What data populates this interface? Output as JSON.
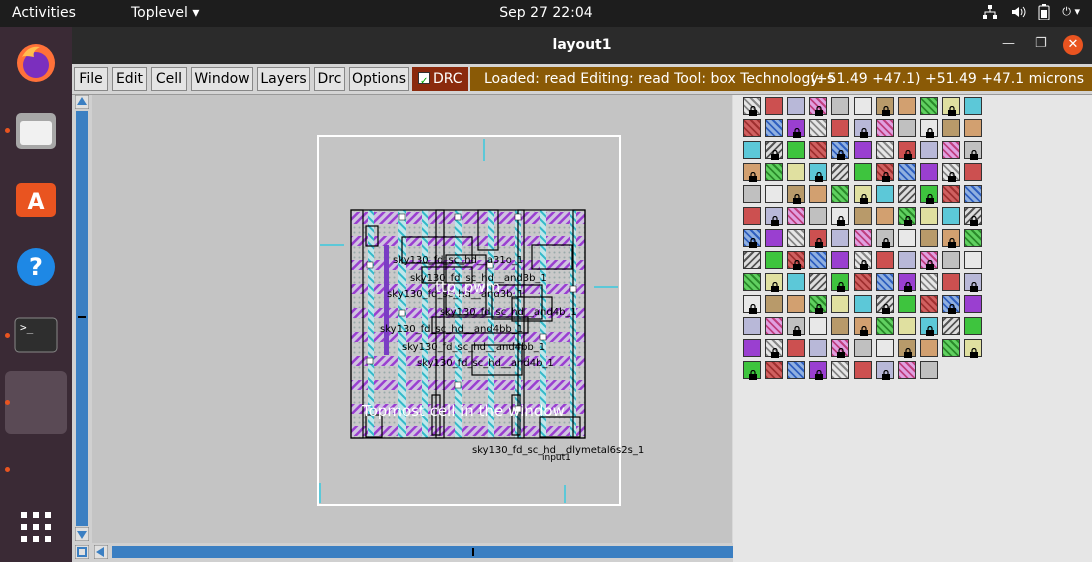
{
  "topbar": {
    "activities": "Activities",
    "app_menu": "Toplevel",
    "clock": "Sep 27  22:04",
    "tray_icons": [
      "network-icon",
      "volume-icon",
      "battery-icon",
      "power-menu-icon"
    ]
  },
  "dock": {
    "items": [
      {
        "name": "firefox",
        "icon": "firefox-icon",
        "running": false
      },
      {
        "name": "files",
        "icon": "files-icon",
        "running": true
      },
      {
        "name": "software",
        "icon": "software-store-icon",
        "running": false
      },
      {
        "name": "help",
        "icon": "help-icon",
        "running": false
      },
      {
        "name": "terminal",
        "icon": "terminal-icon",
        "running": true
      },
      {
        "name": "magic",
        "icon": "app-window-icon",
        "running": true
      },
      {
        "name": "app-grid",
        "icon": "app-grid-icon",
        "running": false
      }
    ],
    "terminal_glyph": ">_",
    "help_glyph": "?"
  },
  "window": {
    "title": "layout1"
  },
  "menu": {
    "file": "File",
    "edit": "Edit",
    "cell": "Cell",
    "window": "Window",
    "layers": "Layers",
    "drc": "Drc",
    "options": "Options"
  },
  "drc_toggle": "DRC",
  "status": {
    "message": "Loaded: read  Editing: read  Tool: box   Technology: s",
    "coords": "(+51.49 +47.1) +51.49 +47.1 microns"
  },
  "layout": {
    "cell_labels": [
      "sky130_fd_sc_hd__a31o_1",
      "sky130_fd_sc_hd__and3b_1",
      "sky130_fd_sc_hd__and4b_1",
      "sky130_fd_sc_hd__and4bb_1",
      "sky130_fd_sc_hd__and4b_1",
      "sky130_fd_sc_hd__dlymetal6s2s_1"
    ],
    "cell_texts": {
      "t1": "sky130_fd_sc_hd__a31o_1",
      "t2": "sky130_fd_sc_hd__and3b_1",
      "t3": "sky130_fd_sc_hd__and3b_1",
      "t4": "sky130_fd_sc_hd__and4b_1",
      "t5": "sky130_fd_sc_hd__and4bb_1",
      "t6": "sky130_fd_sc_hd__and4bb_1",
      "t7": "sky130_fd_sc_hd__and4b_1",
      "t8": "sky130_fd_sc_hd__dlymetal6s2s_1",
      "t9": "input1"
    },
    "instance_label": "ttp_pwm",
    "topmost_label": "Topmost cell in the window"
  },
  "colors": {
    "dock_bg": "#3a2a35",
    "drc_bg": "#8b2a0d",
    "status_bg": "#8a5a06",
    "scroll_blue": "#3b7fc2",
    "canvas_bg": "#c4c4c4"
  }
}
